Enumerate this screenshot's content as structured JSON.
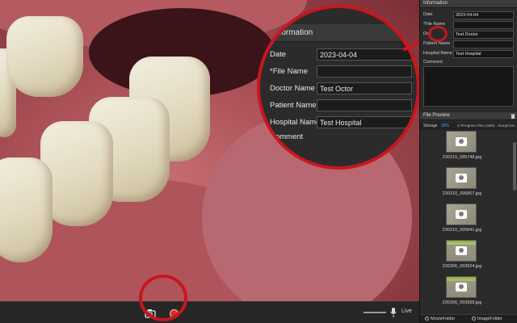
{
  "colors": {
    "accent_red": "#c8161f",
    "storage_blue": "#4aa3ff",
    "record": "#d0332f"
  },
  "magnifier": {
    "header": "nformation",
    "rows": [
      {
        "label": "Date",
        "value": "2023-04-04"
      },
      {
        "label": "*File Name",
        "value": ""
      },
      {
        "label": "Doctor Name",
        "value": "Test Octor"
      },
      {
        "label": "Patient Name",
        "value": ""
      },
      {
        "label": "Hospital Name",
        "value": "Test Hospital"
      },
      {
        "label": "Comment",
        "value": ""
      }
    ]
  },
  "toolbar": {
    "snapshot_icon": "camera-icon",
    "record_icon": "record-icon",
    "live_label": "Live"
  },
  "panel": {
    "info_header": "Information",
    "info_rows": [
      {
        "label": "Date",
        "value": "2023-04-04"
      },
      {
        "label": "*File Name",
        "value": ""
      },
      {
        "label": "Doc",
        "value": "Test Doctor"
      },
      {
        "label": "Patient Name",
        "value": ""
      },
      {
        "label": "Hospital Name",
        "value": "Test Hospital"
      },
      {
        "label": "Comment",
        "value": ""
      }
    ],
    "file_preview_header": "File Preview",
    "storage_label": "Storage",
    "storage_percent": "30%",
    "storage_path": "C:\\Program Files (x86)\\...\\SurgiCam",
    "files": [
      {
        "name": "230210_095748.jpg",
        "ruled": false
      },
      {
        "name": "230210_095807.jpg",
        "ruled": false
      },
      {
        "name": "230210_095841.jpg",
        "ruled": false
      },
      {
        "name": "230306_093924.jpg",
        "ruled": true
      },
      {
        "name": "230306_093958.jpg",
        "ruled": true
      }
    ],
    "folder_tabs": {
      "movie": "MovieFolder",
      "image": "ImageFolder"
    }
  }
}
